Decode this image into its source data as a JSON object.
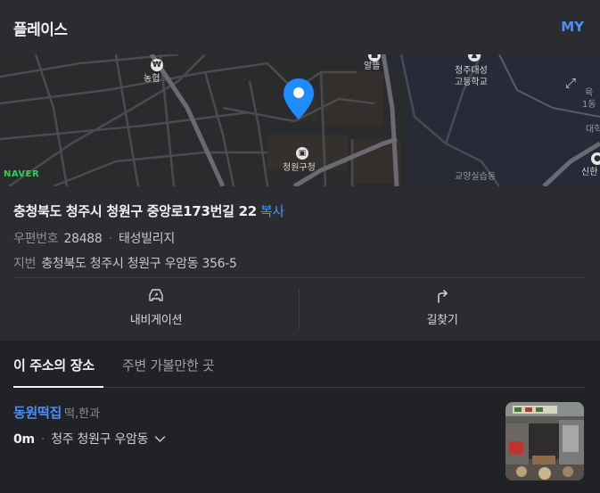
{
  "header": {
    "title": "플레이스",
    "my_label": "MY"
  },
  "map": {
    "labels": {
      "nonghyup": "농협",
      "altteul": "알뜰",
      "school_line1": "청주대성",
      "school_line2": "고등학교",
      "gu_office": "청원구청",
      "interchange": "교양실습동",
      "edge_top_1": "육",
      "edge_top_2": "1동",
      "edge_mid": "대학",
      "edge_bottom": "신한"
    },
    "naver_logo": "NAVER",
    "pin_color": "#1e8cff"
  },
  "address": {
    "road": "충청북도 청주시 청원구 중앙로173번길 22",
    "copy_label": "복사",
    "postal_label": "우편번호",
    "postal_code": "28488",
    "building": "태성빌리지",
    "jibun_label": "지번",
    "jibun": "충청북도 청주시 청원구 우암동 356-5"
  },
  "actions": {
    "navigation": "내비게이션",
    "directions": "길찾기"
  },
  "tabs": [
    {
      "label": "이 주소의 장소",
      "active": true
    },
    {
      "label": "주변 가볼만한 곳",
      "active": false
    }
  ],
  "place": {
    "name": "동원떡집",
    "category": "떡,한과",
    "distance": "0m",
    "location": "청주 청원구 우암동"
  },
  "colors": {
    "accent": "#4e8ef7",
    "background": "#2b2c30",
    "band": "#212225",
    "naver_green": "#2fd059"
  }
}
